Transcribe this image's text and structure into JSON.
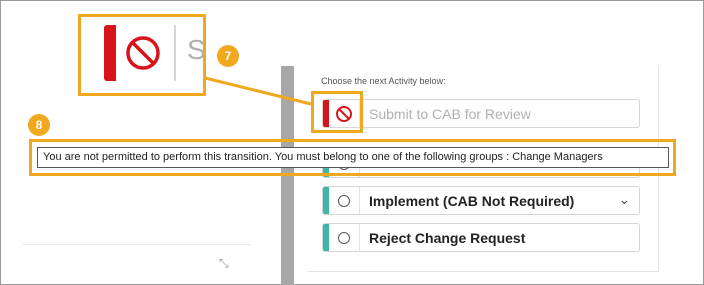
{
  "panel": {
    "prompt": "Choose the next Activity below:"
  },
  "activities": [
    {
      "label": "Submit to CAB for Review",
      "state": "disabled",
      "strip_color": "#d8141b",
      "icon": "no-entry-icon"
    },
    {
      "label": "Implement (CAB Not Required)",
      "state": "available",
      "strip_color": "#3fb5a4",
      "has_dropdown": true
    },
    {
      "label": "Reject Change Request",
      "state": "available",
      "strip_color": "#3fb5a4"
    }
  ],
  "tooltip": {
    "text": "You are not permitted to perform this transition. You must belong to one of the following groups : Change Managers"
  },
  "zoom": {
    "partial_text": "S"
  },
  "callouts": {
    "zoom_badge": "7",
    "tooltip_badge": "8",
    "color": "#f0a81e"
  }
}
